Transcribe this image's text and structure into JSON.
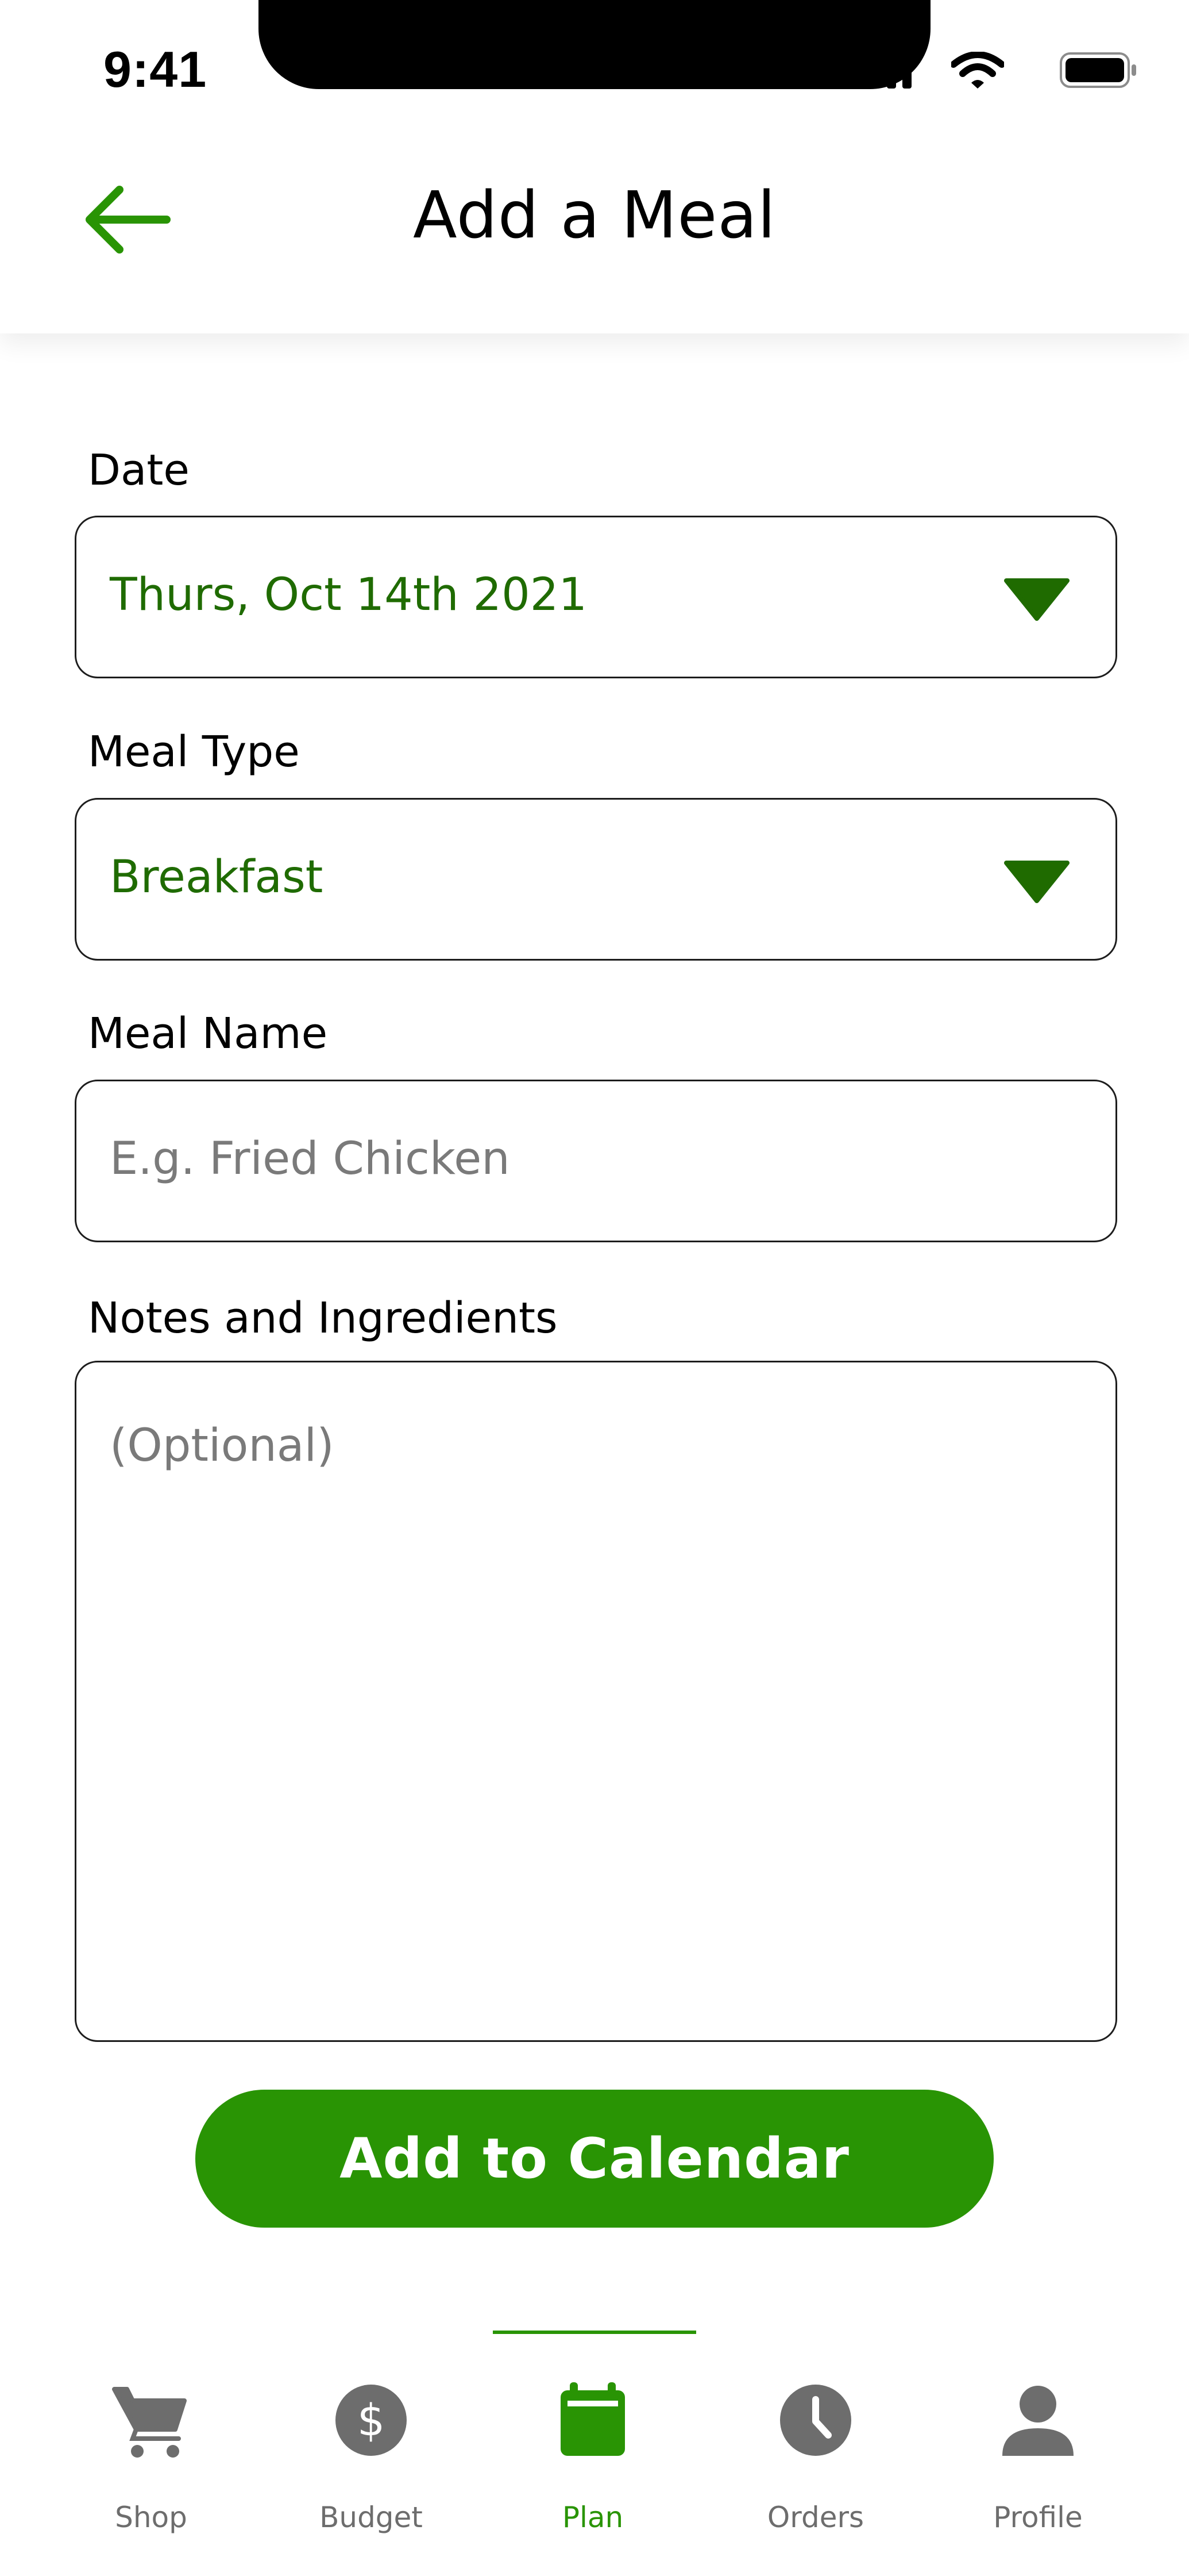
{
  "status_bar": {
    "time": "9:41"
  },
  "header": {
    "title": "Add a Meal"
  },
  "form": {
    "date": {
      "label": "Date",
      "value": "Thurs, Oct 14th 2021"
    },
    "meal_type": {
      "label": "Meal Type",
      "value": "Breakfast"
    },
    "meal_name": {
      "label": "Meal Name",
      "placeholder": "E.g. Fried Chicken"
    },
    "notes": {
      "label": "Notes and Ingredients",
      "placeholder": "(Optional)"
    }
  },
  "submit_label": "Add to Calendar",
  "colors": {
    "accent": "#299404",
    "value_text": "#1f6b00",
    "inactive": "#6d6d6d"
  },
  "nav": {
    "active": "Plan",
    "items": [
      {
        "label": "Shop",
        "icon": "cart-icon"
      },
      {
        "label": "Budget",
        "icon": "dollar-icon"
      },
      {
        "label": "Plan",
        "icon": "calendar-icon"
      },
      {
        "label": "Orders",
        "icon": "clock-icon"
      },
      {
        "label": "Profile",
        "icon": "person-icon"
      }
    ]
  }
}
